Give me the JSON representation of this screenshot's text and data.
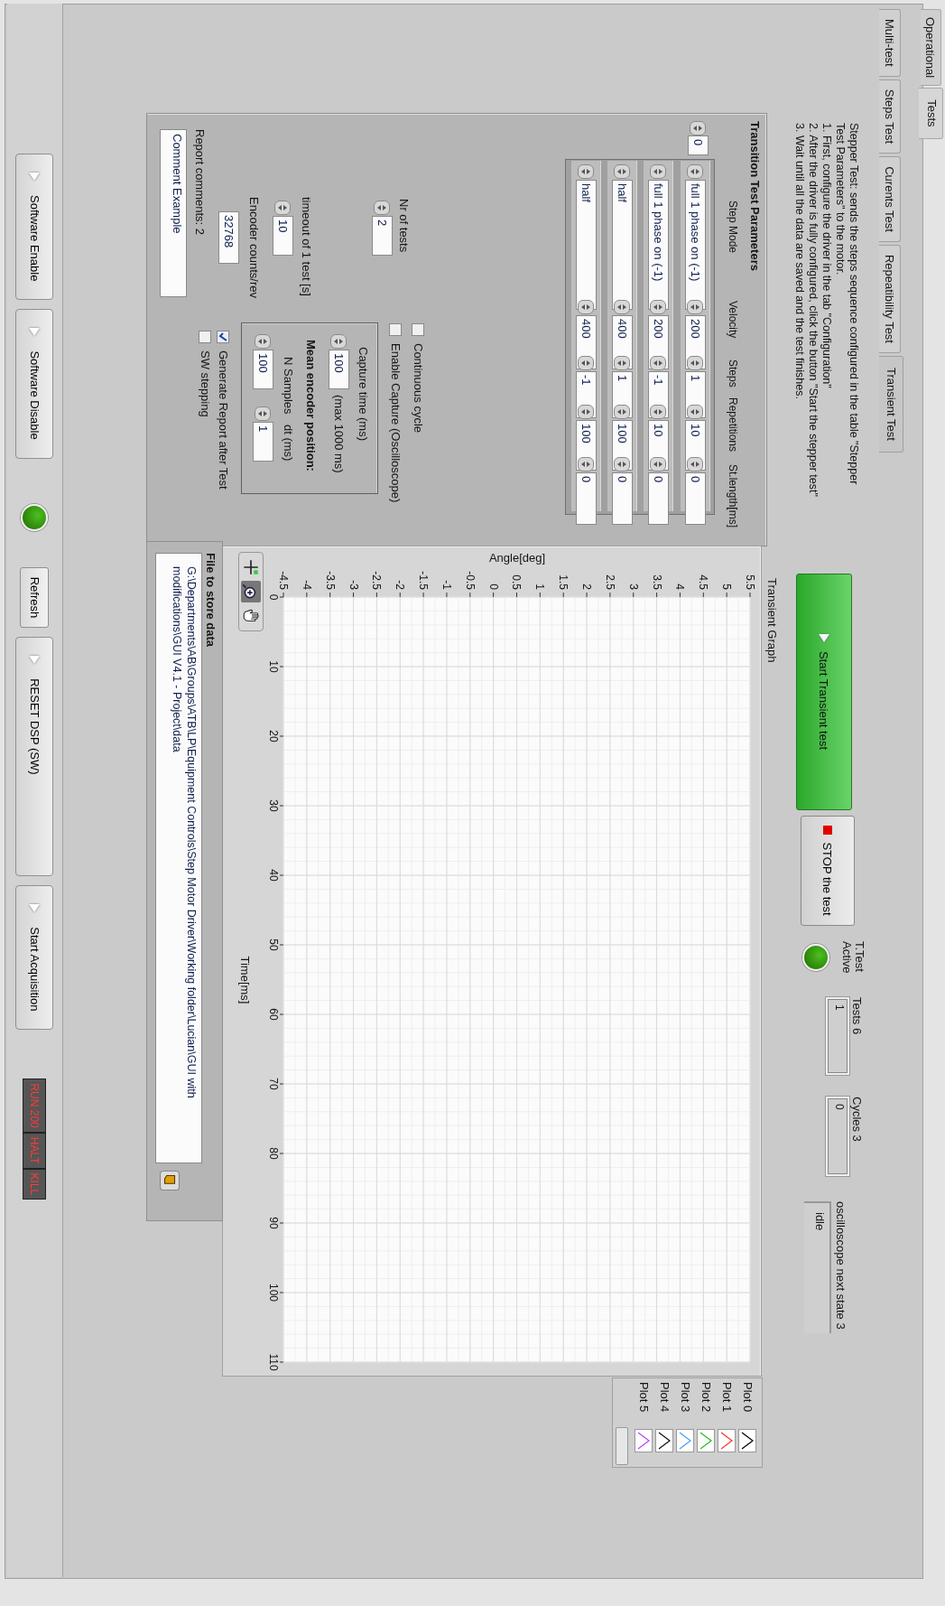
{
  "main_tabs": [
    {
      "label": "Operational",
      "selected": false
    },
    {
      "label": "Tests",
      "selected": true
    }
  ],
  "test_tabs": [
    {
      "label": "Multi-test",
      "selected": false
    },
    {
      "label": "Steps Test",
      "selected": false
    },
    {
      "label": "Curents Test",
      "selected": false
    },
    {
      "label": "Repeatibility Test",
      "selected": false
    },
    {
      "label": "Transient Test",
      "selected": true
    }
  ],
  "description": [
    "Stepper Test: sends the steps sequence configured in the table \"Stepper Test Parameters\" to the motor.",
    "1. First, configure the driver in the tab \"Configuration\"",
    "2. After the driver is fully configured, click the button \"Start the stepper test\"",
    "3. Wait until all the data are saved and the test finishes."
  ],
  "parameters": {
    "title": "Transition Test Parameters",
    "index": "0",
    "headers": [
      "Step Mode",
      "Velocity",
      "Steps",
      "Repetitions",
      "St.length[ms]"
    ],
    "steps": [
      {
        "step_mode": "full 1 phase on (-1)",
        "velocity": "200",
        "steps": "1",
        "repetitions": "10",
        "st_length": "0"
      },
      {
        "step_mode": "full 1 phase on (-1)",
        "velocity": "200",
        "steps": "-1",
        "repetitions": "10",
        "st_length": "0"
      },
      {
        "step_mode": "half",
        "velocity": "400",
        "steps": "1",
        "repetitions": "100",
        "st_length": "0"
      },
      {
        "step_mode": "half",
        "velocity": "400",
        "steps": "-1",
        "repetitions": "100",
        "st_length": "0"
      }
    ],
    "nr_of_tests": {
      "label": "Nr of tests",
      "value": "2"
    },
    "timeout": {
      "label": "timeout of 1 test [s]",
      "value": "10"
    },
    "encoder_counts": {
      "label": "Encoder counts/rev",
      "value": "32768"
    },
    "report_comments": {
      "label": "Report comments: 2",
      "value": "Comment Example"
    },
    "continuous_cycle": {
      "label": "Continuous cycle",
      "checked": false
    },
    "enable_capture": {
      "label": "Enable Capture (Oscilloscope)",
      "checked": false
    },
    "capture_time": {
      "label": "Capture time (ms)",
      "value": "100",
      "note": "(max 1000 ms)"
    },
    "mean_encoder": {
      "title": "Mean encoder position:",
      "n_samples": {
        "label": "N Samples",
        "value": "100"
      },
      "dt": {
        "label": "dt (ms)",
        "value": "1"
      }
    },
    "generate_report": {
      "label": "Generate Report after Test",
      "checked": true
    },
    "sw_stepping": {
      "label": "SW stepping",
      "checked": false
    }
  },
  "start_button": {
    "label": "Start Transient test"
  },
  "stop_button": {
    "label": "STOP the test"
  },
  "active_indicator": {
    "label": "T.Test Active",
    "on": true
  },
  "tests": {
    "label": "Tests 6",
    "value": "1"
  },
  "cycles": {
    "label": "Cycles 3",
    "value": "0"
  },
  "oscilloscope_state": {
    "label": "oscilloscope next state 3",
    "value": "idle"
  },
  "graph": {
    "label": "Transient Graph",
    "chart_data": {
      "type": "line",
      "grid": true,
      "xlabel": "Angle[deg]",
      "ylabel": "Time[ms]",
      "xlim": [
        -4.5,
        5.5
      ],
      "ylim": [
        110,
        0
      ],
      "xticks": [
        {
          "value": -4.5,
          "label": "-4.5"
        },
        {
          "value": -4,
          "label": "-4"
        },
        {
          "value": -3.5,
          "label": "-3.5"
        },
        {
          "value": -3,
          "label": "-3"
        },
        {
          "value": -2.5,
          "label": "-2.5"
        },
        {
          "value": -2,
          "label": "-2"
        },
        {
          "value": -1.5,
          "label": "-1.5"
        },
        {
          "value": -1,
          "label": "-1"
        },
        {
          "value": -0.5,
          "label": "-0.5"
        },
        {
          "value": 0,
          "label": "0"
        },
        {
          "value": 0.5,
          "label": "0.5"
        },
        {
          "value": 1,
          "label": "1"
        },
        {
          "value": 1.5,
          "label": "1.5"
        },
        {
          "value": 2,
          "label": "2"
        },
        {
          "value": 2.5,
          "label": "2.5"
        },
        {
          "value": 3,
          "label": "3"
        },
        {
          "value": 3.5,
          "label": "3.5"
        },
        {
          "value": 4,
          "label": "4"
        },
        {
          "value": 4.5,
          "label": "4.5"
        },
        {
          "value": 5,
          "label": "5"
        },
        {
          "value": 5.5,
          "label": "5.5"
        }
      ],
      "yticks": [
        {
          "value": 0,
          "label": "0"
        },
        {
          "value": 10,
          "label": "10"
        },
        {
          "value": 20,
          "label": "20"
        },
        {
          "value": 30,
          "label": "30"
        },
        {
          "value": 40,
          "label": "40"
        },
        {
          "value": 50,
          "label": "50"
        },
        {
          "value": 60,
          "label": "60"
        },
        {
          "value": 70,
          "label": "70"
        },
        {
          "value": 80,
          "label": "80"
        },
        {
          "value": 90,
          "label": "90"
        },
        {
          "value": 100,
          "label": "100"
        },
        {
          "value": 110,
          "label": "110"
        }
      ]
    },
    "legend": [
      {
        "name": "Plot 0",
        "color": "#000000"
      },
      {
        "name": "Plot 1",
        "color": "#ff3030"
      },
      {
        "name": "Plot 2",
        "color": "#20c020"
      },
      {
        "name": "Plot 3",
        "color": "#40a0ff"
      },
      {
        "name": "Plot 4",
        "color": "#101010"
      },
      {
        "name": "Plot 5",
        "color": "#c040ff"
      }
    ]
  },
  "file": {
    "label": "File to store  data",
    "path": "G:\\Departments\\AB\\Groups\\ATB\\LP\\Equipment Controls\\Step Motor Driver\\Working folder\\Lucian\\GUI with modifications\\GUI V4.1 - Project\\data"
  },
  "bottom_bar": [
    {
      "kind": "switch",
      "label": "Software Enable"
    },
    {
      "kind": "switch",
      "label": "Software Disable"
    },
    {
      "kind": "led",
      "on": true
    },
    {
      "kind": "button",
      "label": "Refresh"
    },
    {
      "kind": "switch",
      "label": "RESET DSP (SW)"
    },
    {
      "kind": "switch",
      "label": "Start Acquisition"
    }
  ],
  "status_tags": [
    "RUN 200",
    "HALT",
    "KILL"
  ]
}
